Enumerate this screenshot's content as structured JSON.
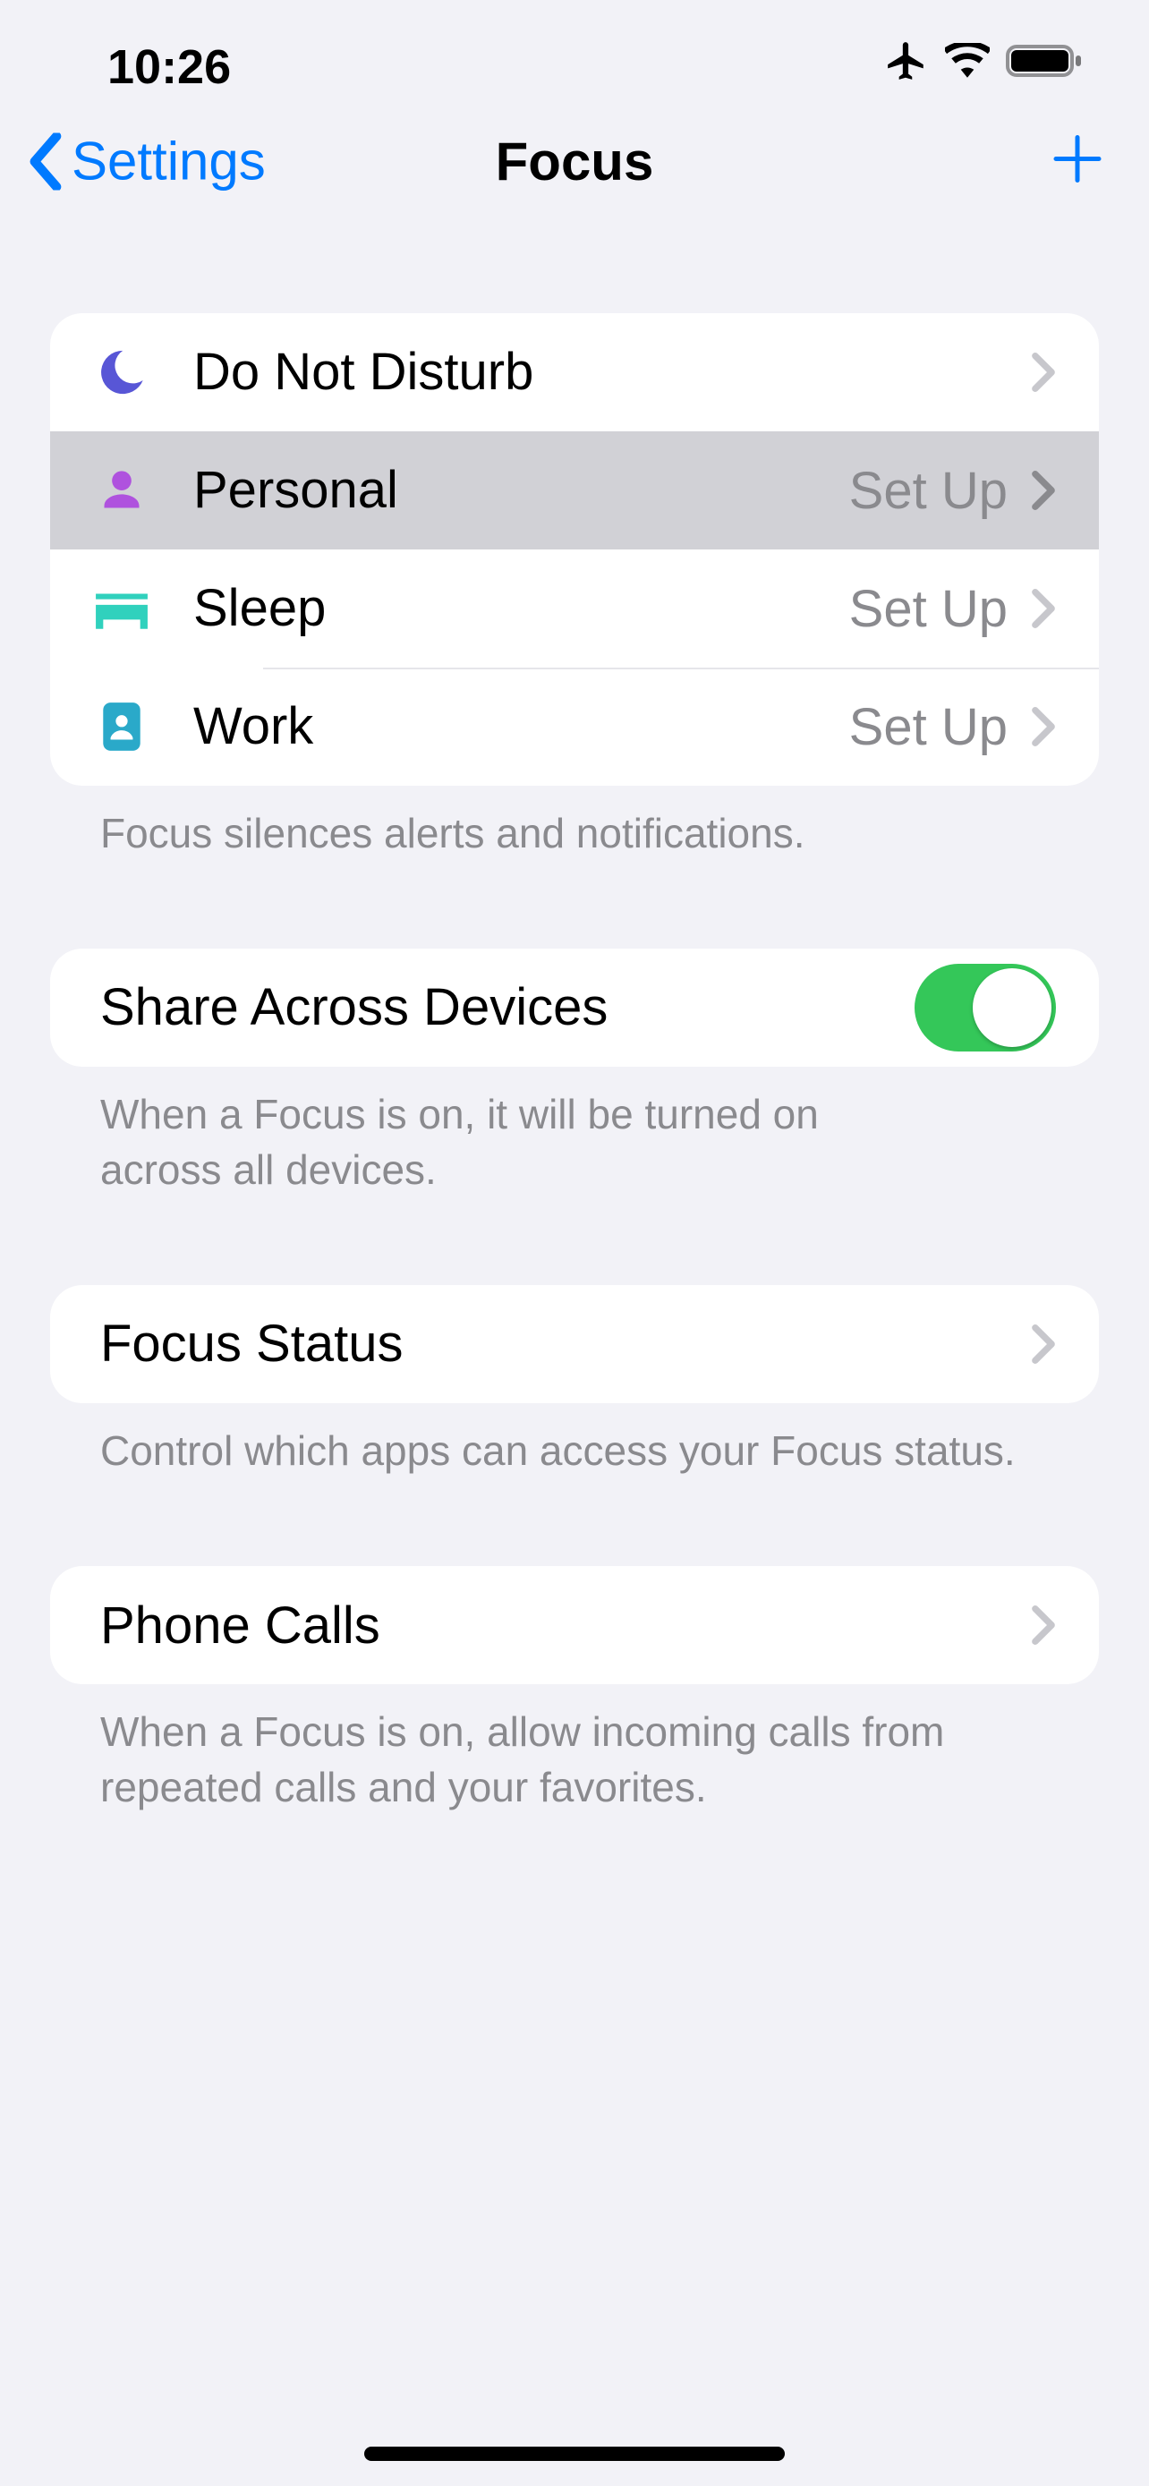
{
  "status": {
    "time": "10:26"
  },
  "nav": {
    "back_label": "Settings",
    "title": "Focus"
  },
  "focus_list": {
    "footer": "Focus silences alerts and notifications.",
    "items": [
      {
        "label": "Do Not Disturb",
        "detail": ""
      },
      {
        "label": "Personal",
        "detail": "Set Up"
      },
      {
        "label": "Sleep",
        "detail": "Set Up"
      },
      {
        "label": "Work",
        "detail": "Set Up"
      }
    ]
  },
  "share": {
    "label": "Share Across Devices",
    "footer": "When a Focus is on, it will be turned on across all devices."
  },
  "status_row": {
    "label": "Focus Status",
    "footer": "Control which apps can access your Focus status."
  },
  "phone": {
    "label": "Phone Calls",
    "footer": "When a Focus is on, allow incoming calls from repeated calls and your favorites."
  }
}
